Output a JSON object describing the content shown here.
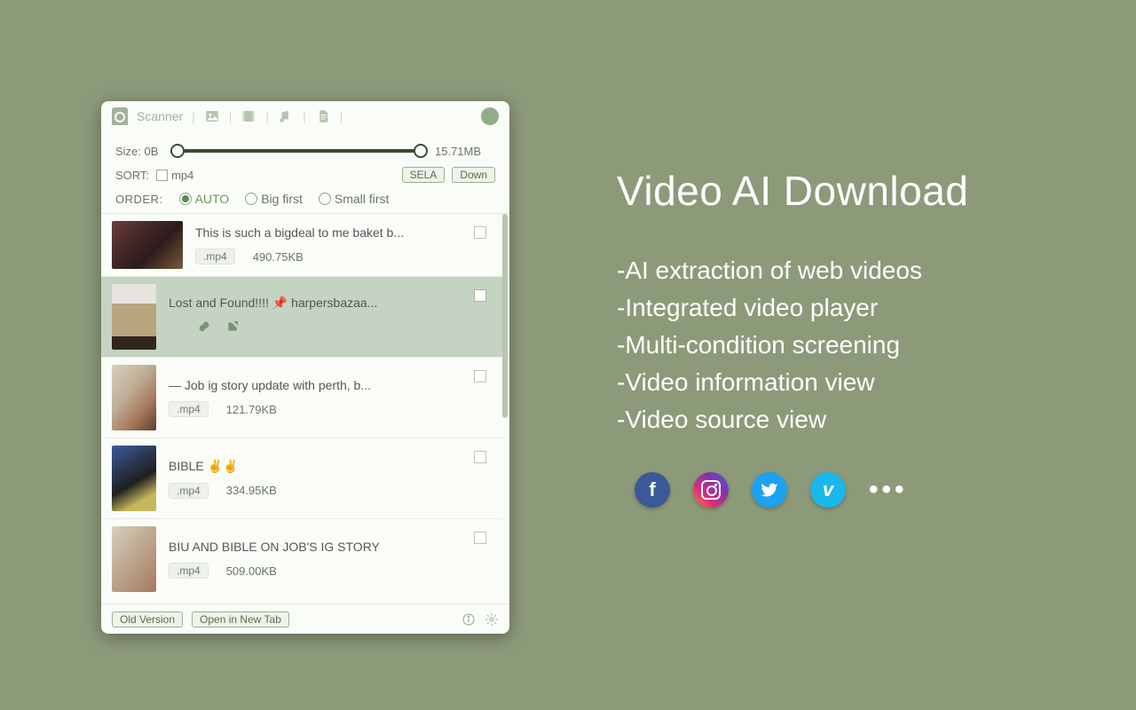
{
  "promo": {
    "title": "Video AI Download",
    "bullets": [
      "-AI extraction of web videos",
      "-Integrated video player",
      "-Multi-condition screening",
      "-Video information view",
      "-Video source view"
    ],
    "more": "•••"
  },
  "panel": {
    "app_name": "Scanner",
    "size_label": "Size: 0B",
    "size_max": "15.71MB",
    "sort_label": "SORT:",
    "sort_filter": "mp4",
    "btn_sela": "SELA",
    "btn_down": "Down",
    "order_label": "ORDER:",
    "order_options": {
      "auto": "AUTO",
      "big": "Big first",
      "small": "Small first"
    },
    "footer": {
      "old": "Old Version",
      "newtab": "Open in New Tab"
    }
  },
  "items": [
    {
      "title": "This is such a bigdeal to me baket b...",
      "ext": ".mp4",
      "size": "490.75KB",
      "thumb": "wide th1",
      "selected": false,
      "actions": false
    },
    {
      "title": "Lost and Found!!!! 📌 harpersbazaa...",
      "ext": "",
      "size": "",
      "thumb": "tall th2",
      "selected": true,
      "actions": true
    },
    {
      "title": "— Job ig story update with perth, b...",
      "ext": ".mp4",
      "size": "121.79KB",
      "thumb": "tall th3",
      "selected": false,
      "actions": false
    },
    {
      "title": "BIBLE ✌️✌️",
      "ext": ".mp4",
      "size": "334.95KB",
      "thumb": "tall th4",
      "selected": false,
      "actions": false
    },
    {
      "title": "BIU AND BIBLE ON JOB'S IG STORY",
      "ext": ".mp4",
      "size": "509.00KB",
      "thumb": "tall th5",
      "selected": false,
      "actions": false
    }
  ]
}
